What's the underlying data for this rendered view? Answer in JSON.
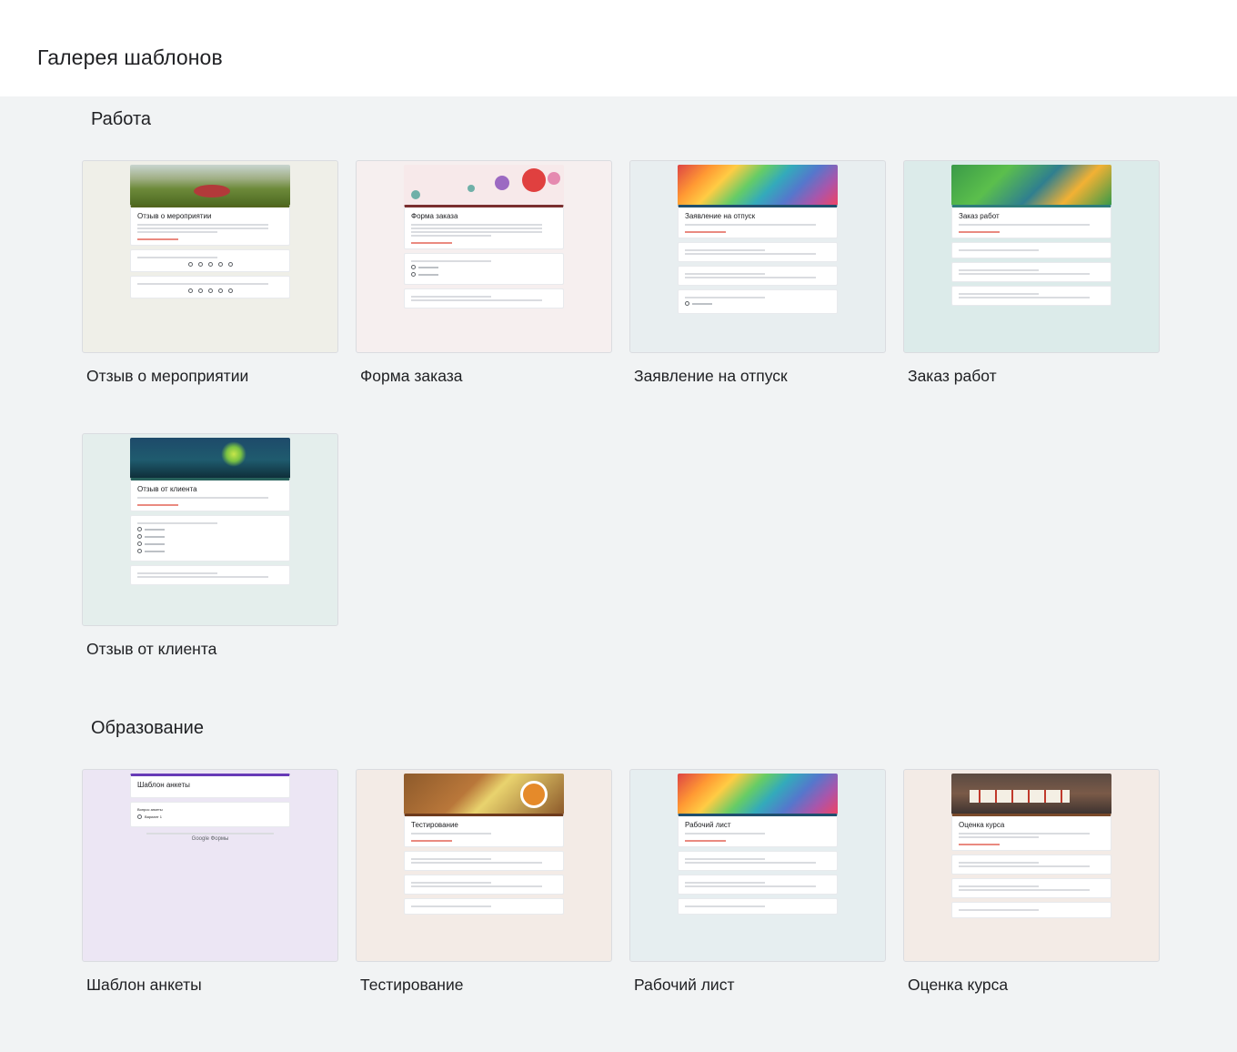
{
  "header": {
    "title": "Галерея шаблонов"
  },
  "sections": [
    {
      "title": "Работа",
      "templates": [
        {
          "label": "Отзыв о мероприятии",
          "form_title": "Отзыв о мероприятии",
          "accent": "#52661f",
          "bg": "#efefe8"
        },
        {
          "label": "Форма заказа",
          "form_title": "Форма заказа",
          "accent": "#7a2f2f",
          "bg": "#f6efef"
        },
        {
          "label": "Заявление на отпуск",
          "form_title": "Заявление на отпуск",
          "accent": "#1f4f6e",
          "bg": "#e8eef0"
        },
        {
          "label": "Заказ работ",
          "form_title": "Заказ работ",
          "accent": "#2e7d7a",
          "bg": "#dcebea"
        },
        {
          "label": "Отзыв от клиента",
          "form_title": "Отзыв от клиента",
          "accent": "#27605a",
          "bg": "#e4eeec"
        }
      ]
    },
    {
      "title": "Образование",
      "templates": [
        {
          "label": "Шаблон анкеты",
          "form_title": "Шаблон анкеты",
          "accent": "#673ab7",
          "bg": "#ece6f4"
        },
        {
          "label": "Тестирование",
          "form_title": "Тестирование",
          "accent": "#6d3a1c",
          "bg": "#f3ebe6"
        },
        {
          "label": "Рабочий лист",
          "form_title": "Рабочий лист",
          "accent": "#1f4f6e",
          "bg": "#e6eef0"
        },
        {
          "label": "Оценка курса",
          "form_title": "Оценка курса",
          "accent": "#7a4a2a",
          "bg": "#f3ebe6"
        }
      ]
    }
  ],
  "survey_preview": {
    "question": "Вопрос анкеты",
    "option": "Вариант 1",
    "brand": "Google Формы"
  }
}
